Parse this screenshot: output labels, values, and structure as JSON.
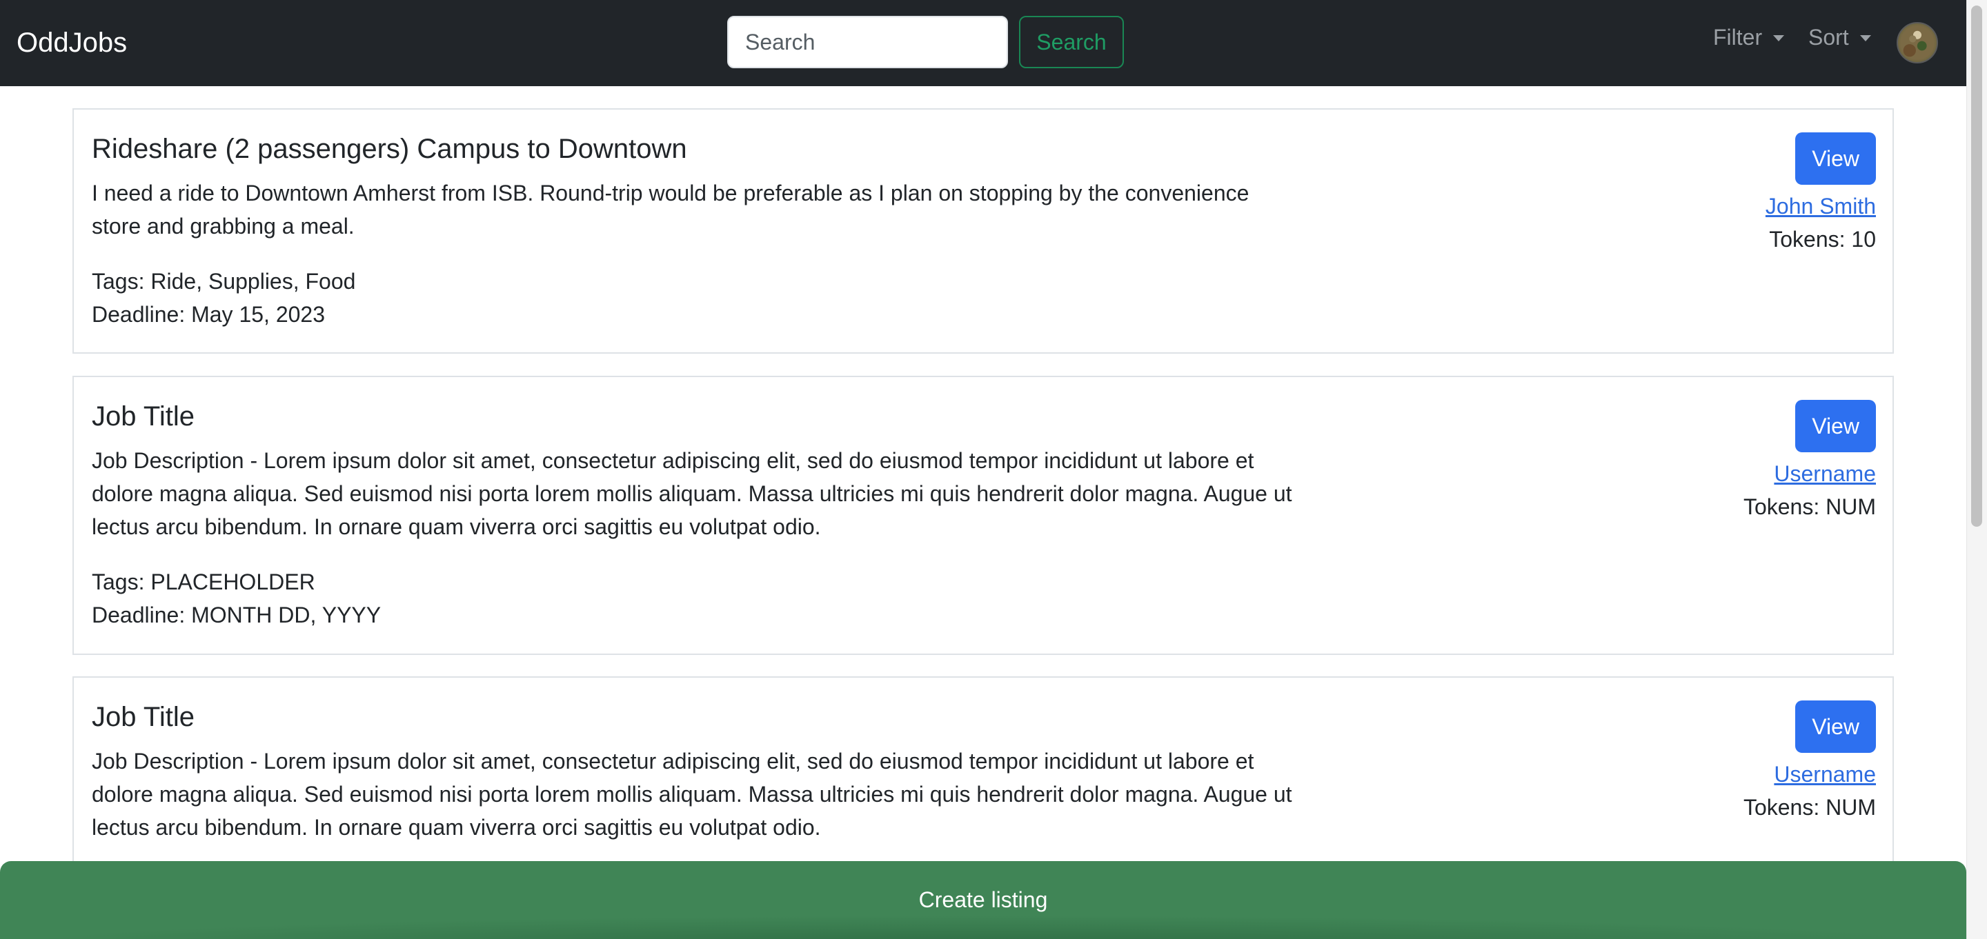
{
  "navbar": {
    "brand": "OddJobs",
    "search_placeholder": "Search",
    "search_button": "Search",
    "filter_label": "Filter",
    "sort_label": "Sort"
  },
  "listings": [
    {
      "title": "Rideshare (2 passengers) Campus to Downtown",
      "description": "I need a ride to Downtown Amherst from ISB. Round-trip would be preferable as I plan on stopping by the convenience store and grabbing a meal.",
      "tags": "Tags: Ride, Supplies, Food",
      "deadline": "Deadline: May 15, 2023",
      "view_label": "View",
      "username": "John Smith",
      "tokens": "Tokens: 10"
    },
    {
      "title": "Job Title",
      "description": "Job Description - Lorem ipsum dolor sit amet, consectetur adipiscing elit, sed do eiusmod tempor incididunt ut labore et dolore magna aliqua. Sed euismod nisi porta lorem mollis aliquam. Massa ultricies mi quis hendrerit dolor magna. Augue ut lectus arcu bibendum. In ornare quam viverra orci sagittis eu volutpat odio.",
      "tags": "Tags: PLACEHOLDER",
      "deadline": "Deadline: MONTH DD, YYYY",
      "view_label": "View",
      "username": "Username",
      "tokens": "Tokens: NUM"
    },
    {
      "title": "Job Title",
      "description": "Job Description - Lorem ipsum dolor sit amet, consectetur adipiscing elit, sed do eiusmod tempor incididunt ut labore et dolore magna aliqua. Sed euismod nisi porta lorem mollis aliquam. Massa ultricies mi quis hendrerit dolor magna. Augue ut lectus arcu bibendum. In ornare quam viverra orci sagittis eu volutpat odio.",
      "view_label": "View",
      "username": "Username",
      "tokens": "Tokens: NUM"
    }
  ],
  "footer": {
    "create_label": "Create listing"
  },
  "colors": {
    "navbar_bg": "#212529",
    "primary_button": "#2d70f0",
    "success_outline": "#198754",
    "create_button": "#408556",
    "link": "#2d6ce0"
  },
  "icons": {
    "filter_caret": "caret-down-icon",
    "sort_caret": "caret-down-icon",
    "avatar": "user-avatar"
  }
}
